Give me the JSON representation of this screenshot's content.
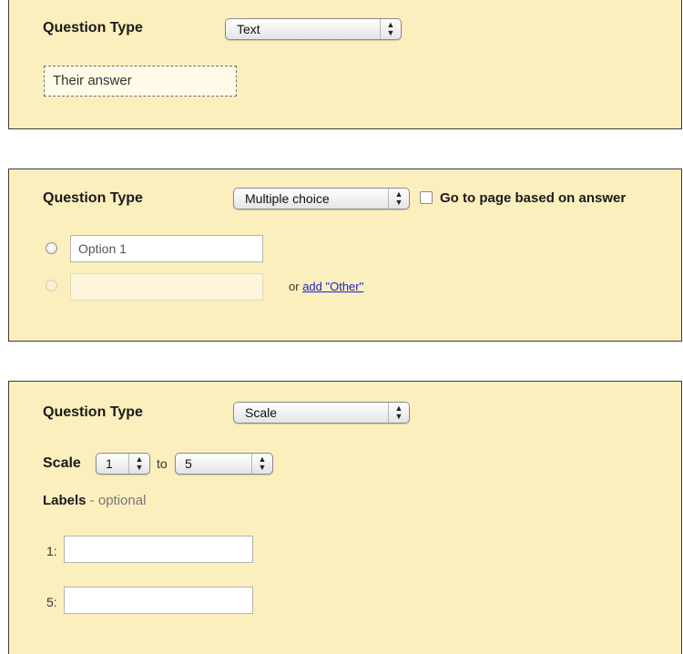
{
  "text_panel": {
    "question_type_label": "Question Type",
    "type_value": "Text",
    "answer_placeholder": "Their answer"
  },
  "mc_panel": {
    "question_type_label": "Question Type",
    "type_value": "Multiple choice",
    "go_to_page_label": "Go to page based on answer",
    "go_to_page_checked": false,
    "option1_value": "Option 1",
    "option2_value": "",
    "or_text": "or",
    "add_other_link": "add \"Other\""
  },
  "scale_panel": {
    "question_type_label": "Question Type",
    "type_value": "Scale",
    "scale_label": "Scale",
    "scale_from": "1",
    "to_text": "to",
    "scale_to": "5",
    "labels_heading": "Labels",
    "labels_optional": "- optional",
    "label1_prefix": "1:",
    "label1_value": "",
    "label5_prefix": "5:",
    "label5_value": ""
  },
  "icons": {
    "select_arrows": "updown-arrows-icon"
  }
}
